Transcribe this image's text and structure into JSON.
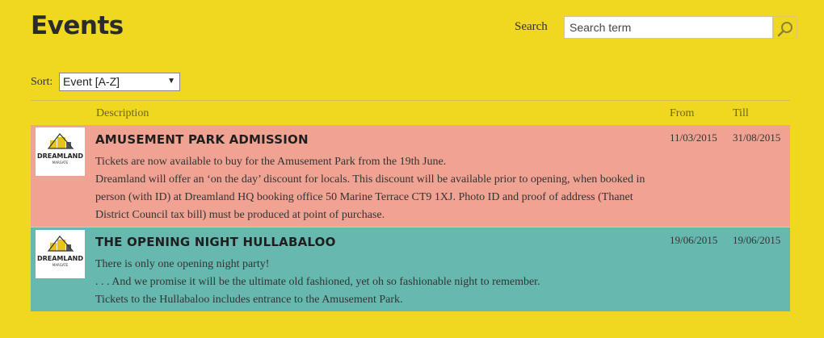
{
  "header": {
    "title": "Events",
    "search_label": "Search",
    "search_placeholder": "Search term",
    "search_icon": "magnifier-icon"
  },
  "sort": {
    "label": "Sort:",
    "selected": "Event [A-Z]"
  },
  "table": {
    "columns": {
      "description": "Description",
      "from": "From",
      "till": "Till"
    },
    "events": [
      {
        "title": "AMUSEMENT PARK ADMISSION",
        "logo_text": "DREAMLAND",
        "logo_subtext": "MARGATE",
        "lines": [
          "Tickets are now available to buy for the Amusement Park from the 19th June.",
          "Dreamland will offer an ‘on the day’ discount for locals. This discount will be available prior to opening, when booked in",
          "person (with ID) at Dreamland HQ booking office 50 Marine Terrace CT9 1XJ. Photo ID and proof of address (Thanet",
          "District Council tax bill) must be produced at point of purchase."
        ],
        "from": "11/03/2015",
        "till": "31/08/2015",
        "color": "#f0a392"
      },
      {
        "title": "THE OPENING NIGHT HULLABALOO",
        "logo_text": "DREAMLAND",
        "logo_subtext": "MARGATE",
        "lines": [
          "There is only one opening night party!",
          ". . . And we promise it will be the ultimate old fashioned, yet oh so fashionable night to remember.",
          "Tickets to the Hullabaloo includes entrance to the Amusement Park."
        ],
        "from": "19/06/2015",
        "till": "19/06/2015",
        "color": "#67b9b0"
      }
    ]
  },
  "colors": {
    "background": "#efd81f",
    "row1": "#f0a392",
    "row2": "#67b9b0"
  }
}
